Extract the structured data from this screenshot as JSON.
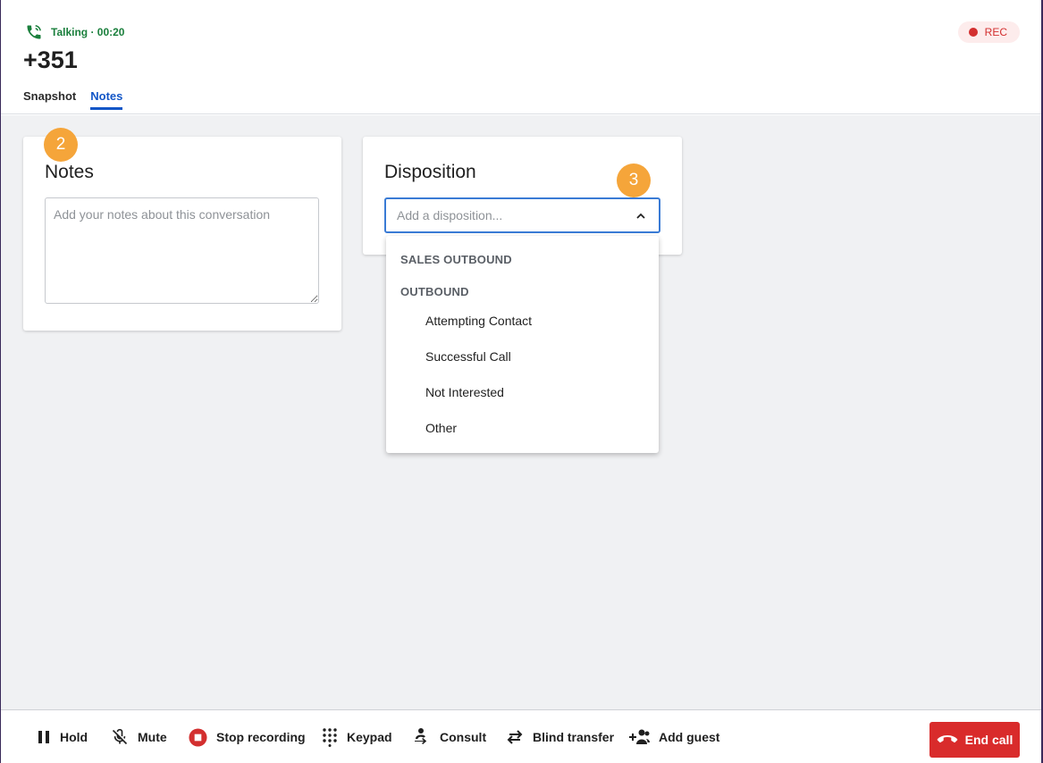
{
  "header": {
    "status": "Talking · 00:20",
    "phone_number": "+351",
    "rec_label": "REC",
    "tabs": [
      {
        "label": "Snapshot",
        "active": false
      },
      {
        "label": "Notes",
        "active": true
      }
    ]
  },
  "notes_card": {
    "title": "Notes",
    "placeholder": "Add your notes about this conversation",
    "step_badge": "2"
  },
  "disposition_card": {
    "title": "Disposition",
    "placeholder": "Add a disposition...",
    "step_badge": "3",
    "groups": [
      {
        "label": "SALES OUTBOUND",
        "options": []
      },
      {
        "label": "OUTBOUND",
        "options": [
          "Attempting Contact",
          "Successful Call",
          "Not Interested",
          "Other"
        ]
      }
    ]
  },
  "footer": {
    "hold": "Hold",
    "mute": "Mute",
    "stop_recording": "Stop recording",
    "keypad": "Keypad",
    "consult": "Consult",
    "blind_transfer": "Blind transfer",
    "add_guest": "Add guest",
    "end_call": "End call"
  },
  "colors": {
    "accent": "#1356c7",
    "talking": "#1a7f3c",
    "rec": "#d32f2f",
    "end_call": "#d92b2b",
    "badge": "#f5a53a"
  }
}
